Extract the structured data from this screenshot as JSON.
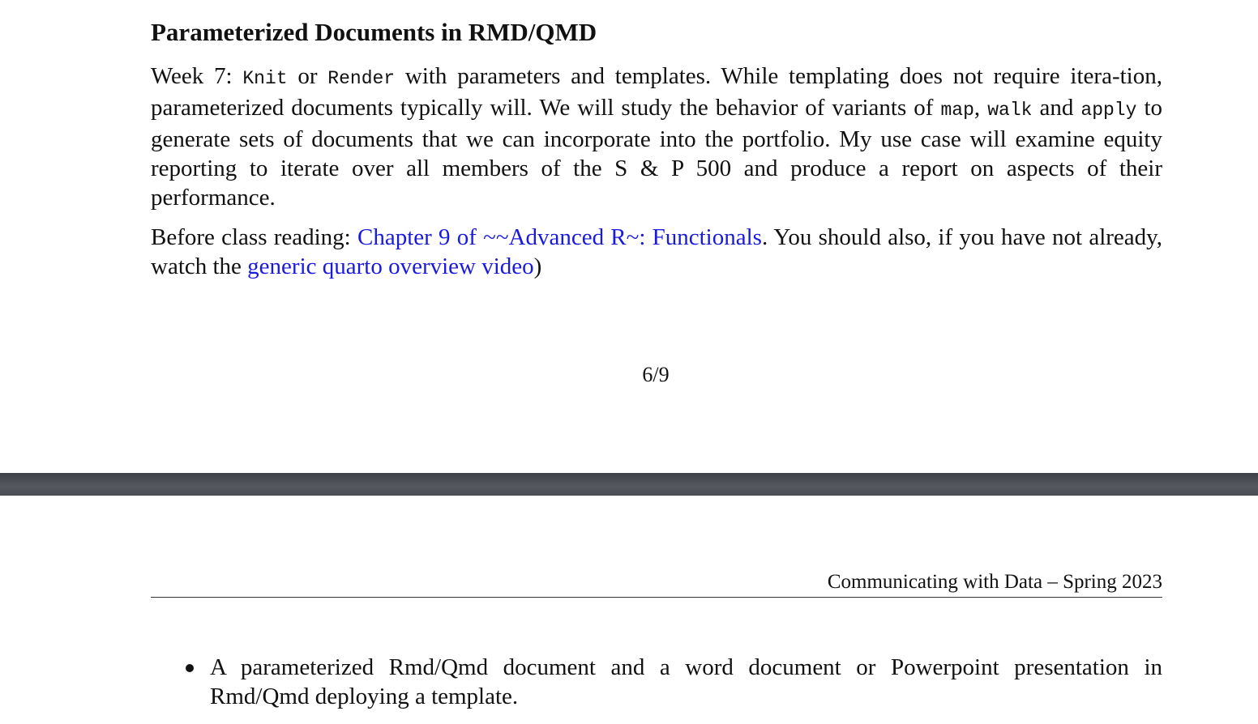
{
  "page1": {
    "heading": "Parameterized Documents in RMD/QMD",
    "para1": {
      "t1": "Week 7: ",
      "c1": "Knit",
      "t2": " or ",
      "c2": "Render",
      "t3": " with parameters and templates. While templating does not require itera-tion, parameterized documents typically will. We will study the behavior of variants of ",
      "c3": "map",
      "t4": ", ",
      "c4": "walk",
      "t5": " and ",
      "c5": "apply",
      "t6": " to generate sets of documents that we can incorporate into the portfolio. My use case will examine equity reporting to iterate over all members of the S & P 500 and produce a report on aspects of their performance."
    },
    "para2": {
      "t1": "Before class reading: ",
      "link1": "Chapter 9 of ~~Advanced R~: Functionals",
      "t2": ". You should also, if you have not already, watch the ",
      "link2": "generic quarto overview video",
      "t3": ")"
    },
    "page_number": "6/9"
  },
  "page2": {
    "running_header": "Communicating with Data – Spring 2023",
    "bullets": [
      "A parameterized Rmd/Qmd document and a word document or Powerpoint presentation in Rmd/Qmd deploying a template."
    ]
  },
  "colors": {
    "link": "#1a1adc",
    "page_gap": "#4a4d52",
    "text": "#111111"
  }
}
